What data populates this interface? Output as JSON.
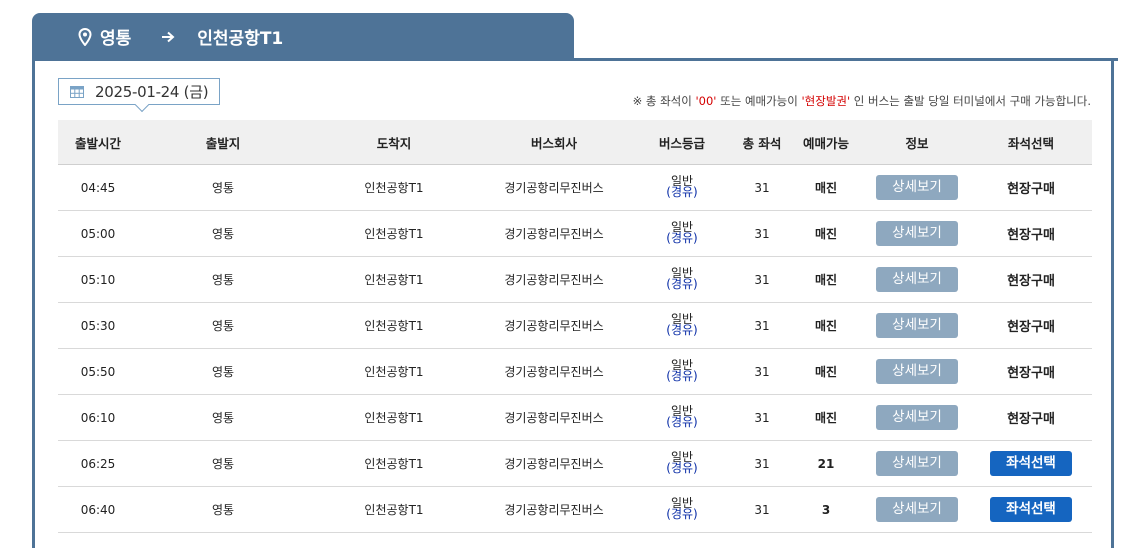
{
  "route": {
    "from": "영통",
    "to": "인천공항T1",
    "icons": {
      "location": "map-pin-icon",
      "direction": "arrow-right-icon"
    }
  },
  "date": {
    "label": "2025-01-24 (금)",
    "icon": "calendar-icon"
  },
  "notice": {
    "prefix": "※ 총 좌석이 ",
    "quote_zero": "'00'",
    "middle": " 또는 예매가능이 ",
    "quote_onsite": "'현장발권'",
    "suffix": " 인 버스는 출발 당일 터미널에서 구매 가능합니다."
  },
  "table": {
    "headers": [
      "출발시간",
      "출발지",
      "도착지",
      "버스회사",
      "버스등급",
      "총 좌석",
      "예매가능",
      "정보",
      "좌석선택"
    ],
    "rows": [
      {
        "time": "04:45",
        "origin": "영통",
        "destination": "인천공항T1",
        "company": "경기공항리무진버스",
        "grade": "일반",
        "via": "(경유)",
        "total": "31",
        "available": "매진",
        "info": "상세보기",
        "action": "현장구매",
        "action_type": "onsite"
      },
      {
        "time": "05:00",
        "origin": "영통",
        "destination": "인천공항T1",
        "company": "경기공항리무진버스",
        "grade": "일반",
        "via": "(경유)",
        "total": "31",
        "available": "매진",
        "info": "상세보기",
        "action": "현장구매",
        "action_type": "onsite"
      },
      {
        "time": "05:10",
        "origin": "영통",
        "destination": "인천공항T1",
        "company": "경기공항리무진버스",
        "grade": "일반",
        "via": "(경유)",
        "total": "31",
        "available": "매진",
        "info": "상세보기",
        "action": "현장구매",
        "action_type": "onsite"
      },
      {
        "time": "05:30",
        "origin": "영통",
        "destination": "인천공항T1",
        "company": "경기공항리무진버스",
        "grade": "일반",
        "via": "(경유)",
        "total": "31",
        "available": "매진",
        "info": "상세보기",
        "action": "현장구매",
        "action_type": "onsite"
      },
      {
        "time": "05:50",
        "origin": "영통",
        "destination": "인천공항T1",
        "company": "경기공항리무진버스",
        "grade": "일반",
        "via": "(경유)",
        "total": "31",
        "available": "매진",
        "info": "상세보기",
        "action": "현장구매",
        "action_type": "onsite"
      },
      {
        "time": "06:10",
        "origin": "영통",
        "destination": "인천공항T1",
        "company": "경기공항리무진버스",
        "grade": "일반",
        "via": "(경유)",
        "total": "31",
        "available": "매진",
        "info": "상세보기",
        "action": "현장구매",
        "action_type": "onsite"
      },
      {
        "time": "06:25",
        "origin": "영통",
        "destination": "인천공항T1",
        "company": "경기공항리무진버스",
        "grade": "일반",
        "via": "(경유)",
        "total": "31",
        "available": "21",
        "info": "상세보기",
        "action": "좌석선택",
        "action_type": "select"
      },
      {
        "time": "06:40",
        "origin": "영통",
        "destination": "인천공항T1",
        "company": "경기공항리무진버스",
        "grade": "일반",
        "via": "(경유)",
        "total": "31",
        "available": "3",
        "info": "상세보기",
        "action": "좌석선택",
        "action_type": "select"
      }
    ]
  },
  "colors": {
    "tab_bg": "#4e7397",
    "detail_button": "#8ea8bf",
    "select_button": "#1565c0",
    "notice_highlight": "#d40000",
    "via_text": "#0b2ea7"
  }
}
